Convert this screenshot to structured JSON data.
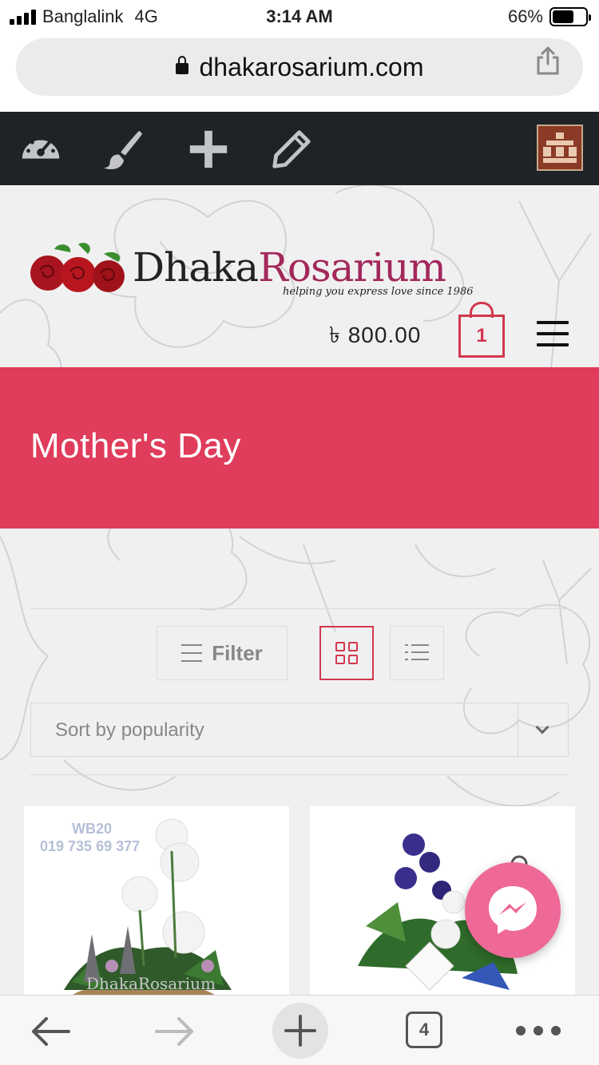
{
  "status_bar": {
    "carrier": "Banglalink",
    "network": "4G",
    "time": "3:14 AM",
    "battery": "66%",
    "battery_level": 0.66
  },
  "browser": {
    "url": "dhakarosarium.com",
    "tab_count": "4"
  },
  "admin_bar": {
    "icons": [
      "dashboard-icon",
      "customize-brush-icon",
      "new-plus-icon",
      "edit-pencil-icon"
    ],
    "avatar_color": "#8b3a25"
  },
  "site": {
    "logo_part1": "Dhaka",
    "logo_part2": "Rosarium",
    "tagline": "helping you express love since 1986",
    "cart_total": "৳ 800.00",
    "cart_count": "1"
  },
  "banner": {
    "title": "Mother's Day",
    "color": "#e03c5b"
  },
  "shop_controls": {
    "filter_label": "Filter",
    "sort_selected": "Sort by popularity",
    "active_view": "grid"
  },
  "products": [
    {
      "watermark_code": "WB20",
      "watermark_phone": "019 735 69 377",
      "watermark_brand": "DhakaRosarium"
    },
    {}
  ],
  "colors": {
    "accent": "#d2384f",
    "admin_bar": "#1e2327",
    "messenger": "#ee6898"
  }
}
